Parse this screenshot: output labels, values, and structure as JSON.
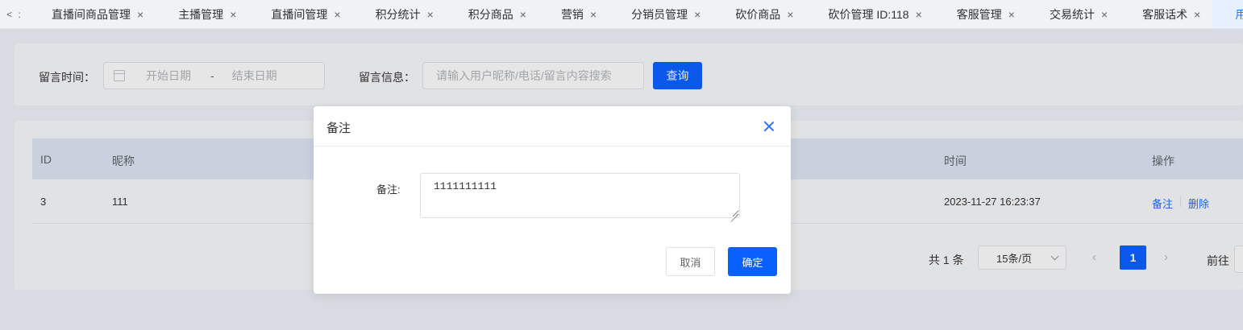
{
  "tabs": {
    "scroll_left": "< :",
    "items": [
      {
        "label": "直播间商品管理",
        "close": "×"
      },
      {
        "label": "主播管理",
        "close": "×"
      },
      {
        "label": "直播间管理",
        "close": "×"
      },
      {
        "label": "积分统计",
        "close": "×"
      },
      {
        "label": "积分商品",
        "close": "×"
      },
      {
        "label": "营销",
        "close": "×"
      },
      {
        "label": "分销员管理",
        "close": "×"
      },
      {
        "label": "砍价商品",
        "close": "×"
      },
      {
        "label": "砍价管理 ID:118",
        "close": "×"
      },
      {
        "label": "客服管理",
        "close": "×"
      },
      {
        "label": "交易统计",
        "close": "×"
      },
      {
        "label": "客服话术",
        "close": "×"
      },
      {
        "label": "用户留言",
        "close": "×",
        "active": true
      }
    ]
  },
  "search": {
    "time_label": "留言时间：",
    "start_placeholder": "开始日期",
    "range_separator": "-",
    "end_placeholder": "结束日期",
    "message_label": "留言信息：",
    "message_placeholder": "请输入用户昵称/电话/留言内容搜索",
    "query_button": "查询"
  },
  "table": {
    "headers": {
      "id": "ID",
      "nickname": "昵称",
      "time": "时间",
      "actions": "操作"
    },
    "rows": [
      {
        "id": "3",
        "nickname": "111",
        "time": "2023-11-27 16:23:37",
        "action_remark": "备注",
        "action_delete": "删除"
      }
    ]
  },
  "pagination": {
    "total": "共 1 条",
    "page_size": "15条/页",
    "prev": "‹",
    "current": "1",
    "next": "›",
    "goto_label": "前往"
  },
  "modal": {
    "title": "备注",
    "field_label": "备注:",
    "remark_value": "1111111111",
    "cancel": "取消",
    "confirm": "确定"
  },
  "colors": {
    "primary": "#0a60ff",
    "link": "#1f6dff",
    "active_tab_bg": "#e6f0ff",
    "table_header_bg": "#dbe3f2"
  }
}
